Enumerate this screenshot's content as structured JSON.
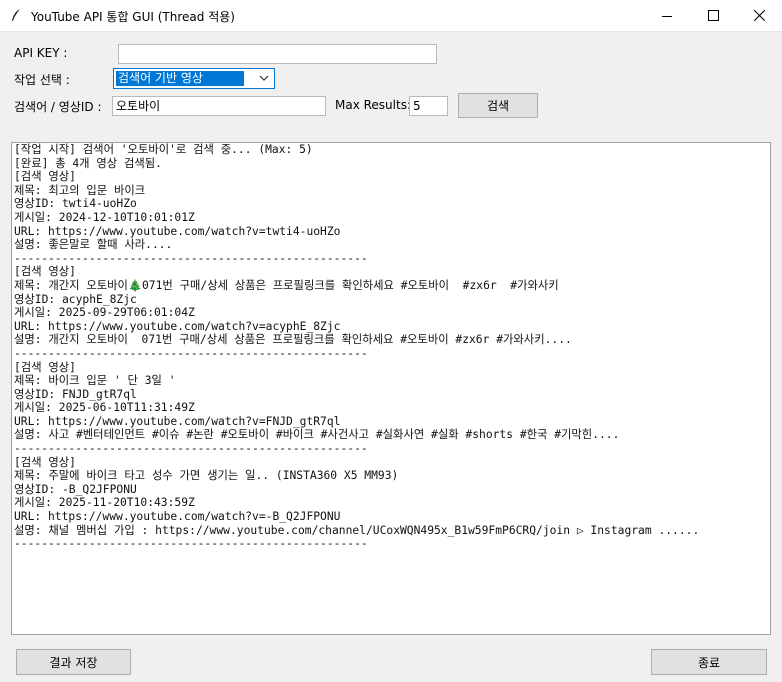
{
  "window": {
    "title": "YouTube API 통합 GUI (Thread 적용)",
    "controls": {
      "minimize": "—",
      "maximize": "☐",
      "close": "✕"
    }
  },
  "form": {
    "api_key_label": "API KEY :",
    "api_key_value": "",
    "task_label": "작업 선택 :",
    "task_selected": "검색어 기반 영상",
    "query_label": "검색어 / 영상ID :",
    "query_value": "오토바이",
    "max_results_label": "Max Results:",
    "max_results_value": "5",
    "search_button": "검색"
  },
  "log_lines": [
    "[작업 시작] 검색어 '오토바이'로 검색 중... (Max: 5)",
    "[완료] 총 4개 영상 검색됨.",
    "[검색 영상]",
    "제목: 최고의 입문 바이크",
    "영상ID: twti4-uoHZo",
    "게시일: 2024-12-10T10:01:01Z",
    "URL: https://www.youtube.com/watch?v=twti4-uoHZo",
    "설명: 좋은말로 할때 사라....",
    "----------------------------------------------------",
    "[검색 영상]",
    "제목: 개간지 오토바이🎄071번 구매/상세 상품은 프로필링크를 확인하세요 #오토바이  #zx6r  #가와사키",
    "영상ID: acyphE_8Zjc",
    "게시일: 2025-09-29T06:01:04Z",
    "URL: https://www.youtube.com/watch?v=acyphE_8Zjc",
    "설명: 개간지 오토바이  071번 구매/상세 상품은 프로필링크를 확인하세요 #오토바이 #zx6r #가와사키....",
    "----------------------------------------------------",
    "[검색 영상]",
    "제목: 바이크 입문 ' 단 3일 '",
    "영상ID: FNJD_gtR7ql",
    "게시일: 2025-06-10T11:31:49Z",
    "URL: https://www.youtube.com/watch?v=FNJD_gtR7ql",
    "설명: 사고 #벤터테인먼트 #이슈 #논란 #오토바이 #바이크 #사건사고 #실화사연 #실화 #shorts #한국 #기막힌....",
    "----------------------------------------------------",
    "[검색 영상]",
    "제목: 주말에 바이크 타고 성수 가면 생기는 일.. (INSTA360 X5 MM93)",
    "영상ID: -B_Q2JFPONU",
    "게시일: 2025-11-20T10:43:59Z",
    "URL: https://www.youtube.com/watch?v=-B_Q2JFPONU",
    "설명: 채널 멤버십 가입 : https://www.youtube.com/channel/UCoxWQN495x_B1w59FmP6CRQ/join ▷ Instagram ......",
    "----------------------------------------------------"
  ],
  "footer": {
    "save_button": "결과 저장",
    "exit_button": "종료"
  }
}
